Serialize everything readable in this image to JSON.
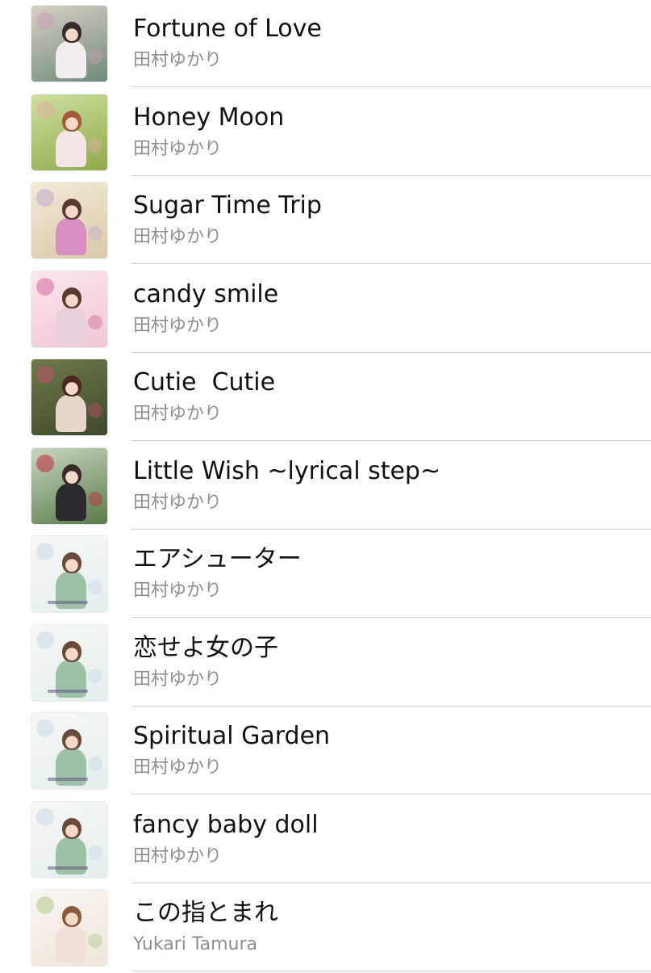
{
  "songs": [
    {
      "title": "Fortune of Love",
      "artist": "田村ゆかり",
      "art_icon": "album-art-parasol-girl",
      "art_colors": [
        "#6f8a7a",
        "#d8d0c6",
        "#3a2a2a",
        "#f2eef0",
        "#c9a0b4"
      ]
    },
    {
      "title": "Honey Moon",
      "artist": "田村ゆかり",
      "art_icon": "album-art-garden-lawn",
      "art_colors": [
        "#8fa94a",
        "#cfe0a0",
        "#a35a3a",
        "#f4e6e6",
        "#e0b0a0"
      ]
    },
    {
      "title": "Sugar Time Trip",
      "artist": "田村ゆかり",
      "art_icon": "album-art-pink-room",
      "art_colors": [
        "#d9c9a8",
        "#f2ead8",
        "#5a3a30",
        "#d58fc0",
        "#c1a8d0"
      ]
    },
    {
      "title": "candy smile",
      "artist": "田村ゆかり",
      "art_icon": "album-art-candy-pink",
      "art_colors": [
        "#f0c6d6",
        "#fbe6ee",
        "#5a3a30",
        "#e8d0dc",
        "#d16a9a"
      ]
    },
    {
      "title": "Cutie  Cutie",
      "artist": "田村ゆかり",
      "art_icon": "album-art-dark-garden",
      "art_colors": [
        "#3e4a2c",
        "#6d7a4a",
        "#4a2a20",
        "#e6d6cc",
        "#c0506a"
      ]
    },
    {
      "title": "Little Wish ~lyrical step~",
      "artist": "田村ゆかり",
      "art_icon": "album-art-rose-garden",
      "art_colors": [
        "#5a7a4a",
        "#c8d6c0",
        "#3a2a2a",
        "#2a2a30",
        "#c02a3a"
      ]
    },
    {
      "title": "エアシューター",
      "artist": "田村ゆかり",
      "art_icon": "album-art-pastel-garden",
      "art_colors": [
        "#e4eef0",
        "#f6f8f4",
        "#6a4a3a",
        "#9fc0a8",
        "#c8d8e6"
      ]
    },
    {
      "title": "恋せよ女の子",
      "artist": "田村ゆかり",
      "art_icon": "album-art-pastel-garden",
      "art_colors": [
        "#e4eef0",
        "#f6f8f4",
        "#6a4a3a",
        "#9fc0a8",
        "#c8d8e6"
      ]
    },
    {
      "title": "Spiritual Garden",
      "artist": "田村ゆかり",
      "art_icon": "album-art-pastel-garden",
      "art_colors": [
        "#e4eef0",
        "#f6f8f4",
        "#6a4a3a",
        "#9fc0a8",
        "#c8d8e6"
      ]
    },
    {
      "title": "fancy baby doll",
      "artist": "田村ゆかり",
      "art_icon": "album-art-pastel-garden",
      "art_colors": [
        "#e4eef0",
        "#f6f8f4",
        "#6a4a3a",
        "#9fc0a8",
        "#c8d8e6"
      ]
    },
    {
      "title": "この指とまれ",
      "artist": "Yukari Tamura",
      "art_icon": "album-art-flower-wreath",
      "art_colors": [
        "#efe6dc",
        "#faf6f0",
        "#8a5a3a",
        "#f2e0d8",
        "#b0c890"
      ]
    }
  ],
  "colors": {
    "background": "#ffffff",
    "title_text": "#111111",
    "artist_text": "#8e8e93",
    "divider": "#d1d1d6"
  }
}
